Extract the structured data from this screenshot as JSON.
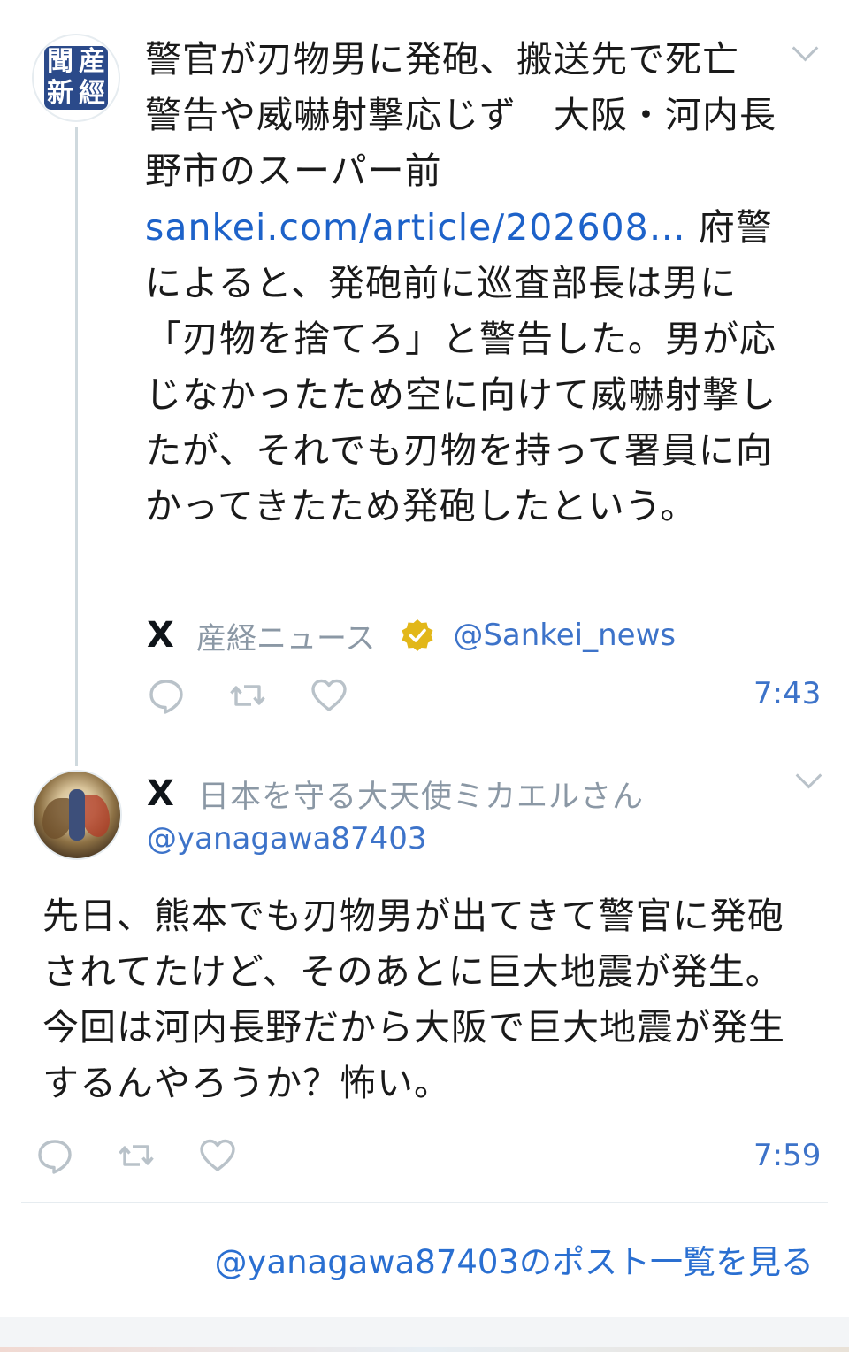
{
  "post1": {
    "title": "警官が刃物男に発砲、搬送先で死亡　警告や威嚇射撃応じず　大阪・河内長野市のスーパー前",
    "link": "sankei.com/article/202608…",
    "body": " 府警によると、発砲前に巡査部長は男に「刃物を捨てろ」と警告した。男が応じなかったため空に向けて威嚇射撃したが、それでも刃物を持って署員に向かってきたため発砲したという。",
    "source_name": "産経ニュース",
    "handle": "@Sankei_news",
    "time": "7:43",
    "avatar_glyphs": [
      "産",
      "經",
      "新",
      "聞"
    ]
  },
  "post2": {
    "user_name": "日本を守る大天使ミカエルさん",
    "handle": "@yanagawa87403",
    "body": "先日、熊本でも刃物男が出てきて警官に発砲されてたけど、そのあとに巨大地震が発生。今回は河内長野だから大阪で巨大地震が発生するんやろうか？怖い。",
    "time": "7:59"
  },
  "footer": {
    "see_more": "@yanagawa87403のポスト一覧を見る"
  },
  "icons": {
    "platform": "X",
    "reply": "reply-icon",
    "repost": "repost-icon",
    "like": "heart-icon",
    "verified": "verified-badge-icon",
    "more": "chevron-down-icon"
  },
  "colors": {
    "link": "#1d62c9",
    "muted": "#8b98a5",
    "verified_gold": "#e2b719",
    "seal_blue": "#2b4a8a"
  }
}
